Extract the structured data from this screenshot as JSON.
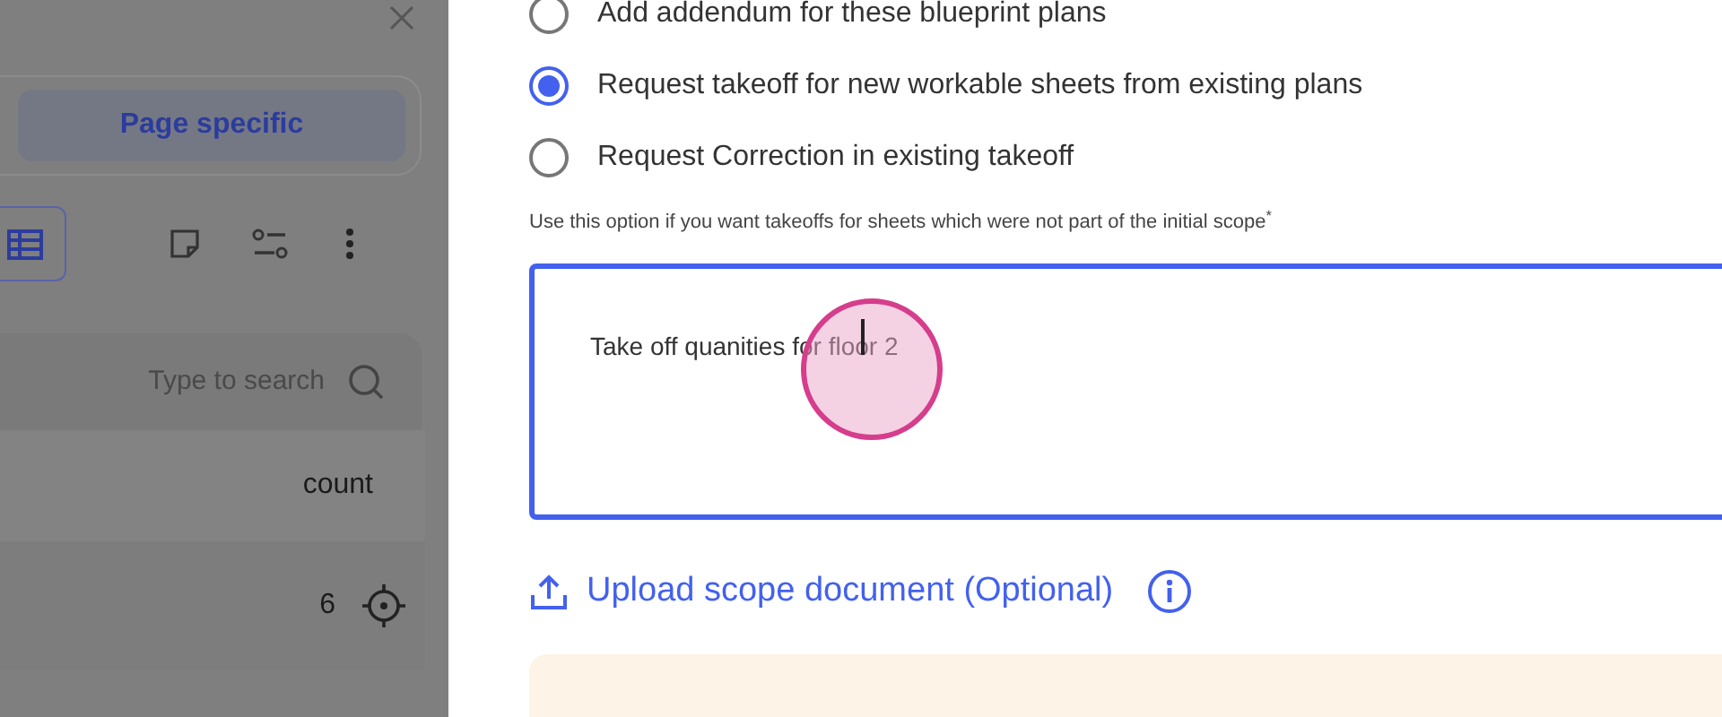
{
  "side_panel": {
    "tabs": [
      {
        "label": "Page specific",
        "selected": true
      }
    ],
    "search": {
      "placeholder": "Type to search"
    },
    "table": {
      "columns": [
        "count"
      ],
      "rows": [
        {
          "count": "6"
        }
      ]
    }
  },
  "options": [
    {
      "label": "Add addendum for these blueprint plans",
      "selected": false
    },
    {
      "label": "Request takeoff for new workable sheets from existing plans",
      "selected": true
    },
    {
      "label": "Request Correction in existing takeoff",
      "selected": false
    }
  ],
  "hint": "Use this option if you want takeoffs for sheets which were not part of the initial scope$^{*}$",
  "scope_field": {
    "value": "Take off quanities for floor 2"
  },
  "upload_link": "Upload scope document (Optional)"
}
